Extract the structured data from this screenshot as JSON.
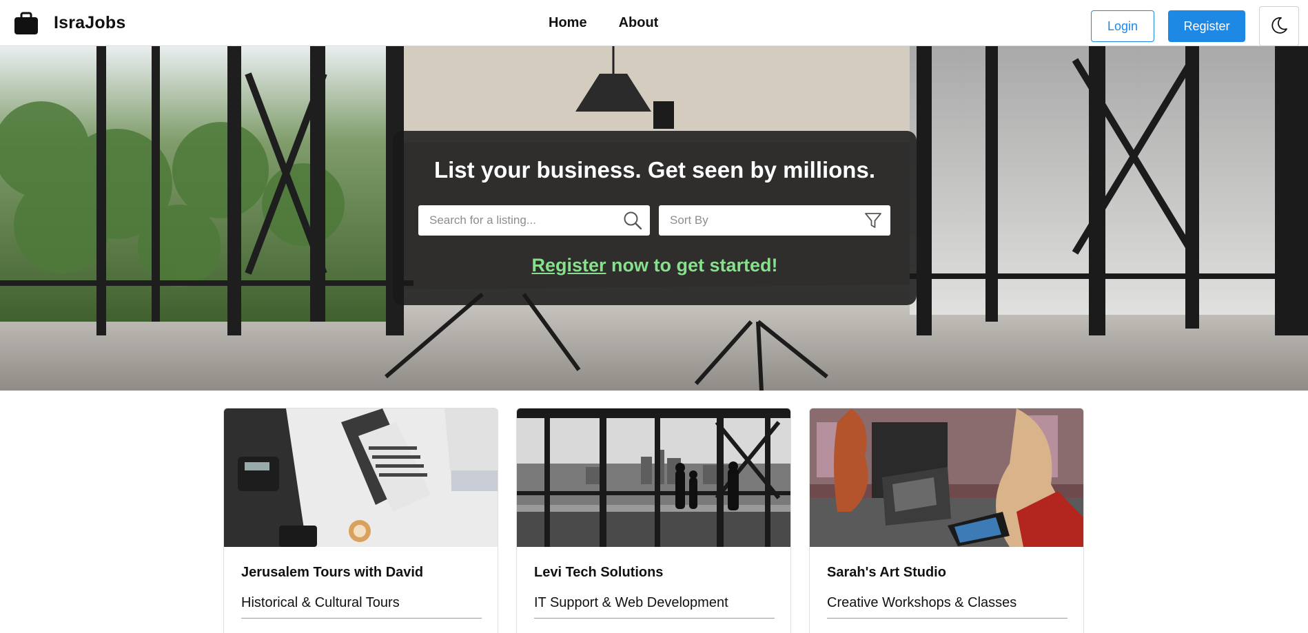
{
  "brand": {
    "name": "IsraJobs",
    "icon": "briefcase-icon"
  },
  "nav": {
    "links": [
      "Home",
      "About"
    ]
  },
  "auth": {
    "login_label": "Login",
    "register_label": "Register",
    "theme_icon": "moon-icon"
  },
  "hero": {
    "title": "List your business. Get seen by millions.",
    "search": {
      "placeholder": "Search for a listing...",
      "icon": "search-icon"
    },
    "sort": {
      "label": "Sort By",
      "icon": "filter-icon"
    },
    "cta": {
      "link_text": "Register",
      "rest_text": " now to get started!"
    }
  },
  "cards": [
    {
      "title": "Jerusalem Tours with David",
      "subtitle": "Historical & Cultural Tours"
    },
    {
      "title": "Levi Tech Solutions",
      "subtitle": "IT Support & Web Development"
    },
    {
      "title": "Sarah's Art Studio",
      "subtitle": "Creative Workshops & Classes"
    }
  ],
  "colors": {
    "accent": "#1e88e5",
    "cta_green": "#86e08c",
    "panel": "#181818"
  }
}
